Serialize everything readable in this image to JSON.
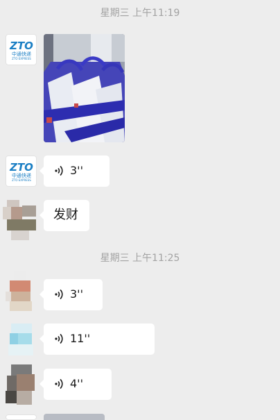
{
  "timestamps": [
    "星期三 上午11:19",
    "星期三 上午11:25"
  ],
  "messages": [
    {
      "sender": "ZTO",
      "type": "image"
    },
    {
      "sender": "ZTO",
      "type": "voice",
      "duration": "3''"
    },
    {
      "sender": "user-a",
      "type": "text",
      "text": "发财"
    },
    {
      "sender": "user-b",
      "type": "voice",
      "duration": "3''"
    },
    {
      "sender": "user-c",
      "type": "voice",
      "duration": "11''"
    },
    {
      "sender": "user-d",
      "type": "voice",
      "duration": "4''"
    }
  ],
  "brand": {
    "logo_text": "ZTO",
    "logo_cn": "中通快递",
    "logo_en": "ZTO EXPRESS",
    "color": "#1b7fc4"
  },
  "colors": {
    "background": "#ededed",
    "bubble": "#ffffff",
    "timestamp": "#a2a2a2"
  }
}
